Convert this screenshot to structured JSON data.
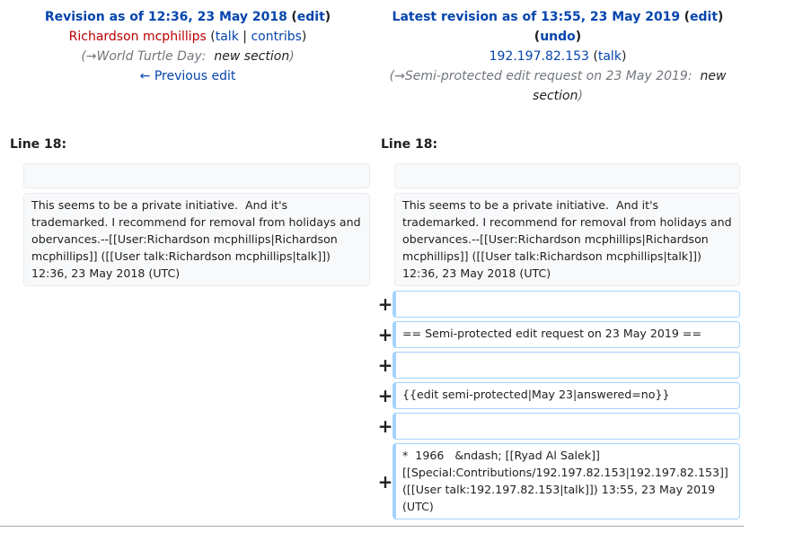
{
  "left_header": {
    "prefix": "Revision as of 12:36, 23 May 2018",
    "edit_label": "edit",
    "user": "Richardson mcphillips",
    "talk_label": "talk",
    "separator": "|",
    "contribs_label": "contribs",
    "arrow": "→",
    "comment_section": "World Turtle Day:",
    "comment_suffix": "new section",
    "prev_edit": "← Previous edit"
  },
  "right_header": {
    "prefix": "Latest revision as of 13:55, 23 May 2019",
    "edit_label": "edit",
    "undo_label": "undo",
    "user": "192.197.82.153",
    "talk_label": "talk",
    "arrow": "→",
    "comment_section": "Semi-protected edit request on 23 May 2019:",
    "comment_suffix": "new section"
  },
  "left_line_label": "Line 18:",
  "right_line_label": "Line 18:",
  "context_text": "This seems to be a private initiative.  And it's trademarked. I recommend for removal from holidays and obervances.--[[User:Richardson mcphillips|Richardson mcphillips]] ([[User talk:Richardson mcphillips|talk]]) 12:36, 23 May 2018 (UTC)",
  "added_marker": "+",
  "added_lines": [
    "",
    "== Semi-protected edit request on 23 May 2019 ==",
    "",
    "{{edit semi-protected|May 23|answered=no}}",
    "",
    "*  1966   &ndash; [[Ryad Al Salek]] [[Special:Contributions/192.197.82.153|192.197.82.153]] ([[User talk:192.197.82.153|talk]]) 13:55, 23 May 2019 (UTC)"
  ]
}
